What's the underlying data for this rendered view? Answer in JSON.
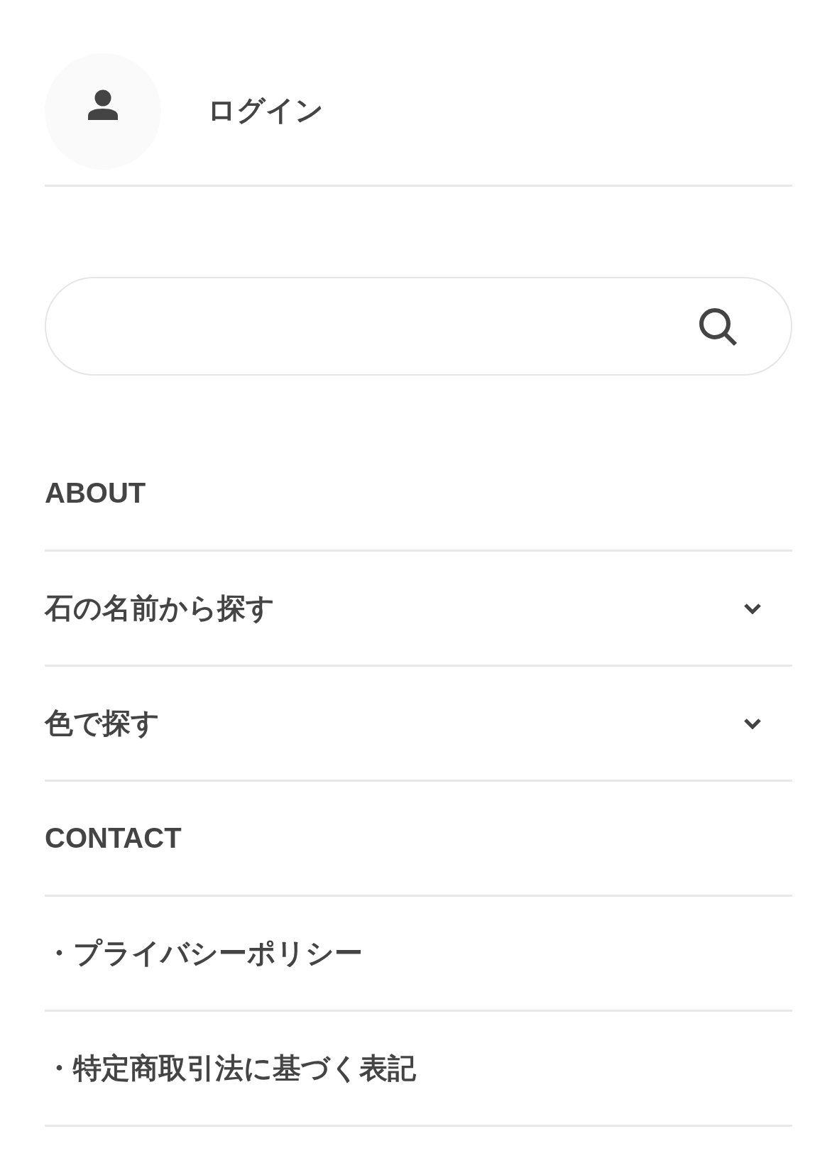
{
  "account": {
    "login_label": "ログイン"
  },
  "menu": [
    {
      "kind": "link",
      "label": "ABOUT"
    },
    {
      "kind": "dropdown",
      "label": "石の名前から探す",
      "expanded": false
    },
    {
      "kind": "dropdown",
      "label": "色で探す",
      "expanded": false
    },
    {
      "kind": "link",
      "label": "CONTACT"
    },
    {
      "kind": "link",
      "label": "・プライバシーポリシー"
    },
    {
      "kind": "link",
      "label": "・特定商取引法に基づく表記"
    }
  ]
}
